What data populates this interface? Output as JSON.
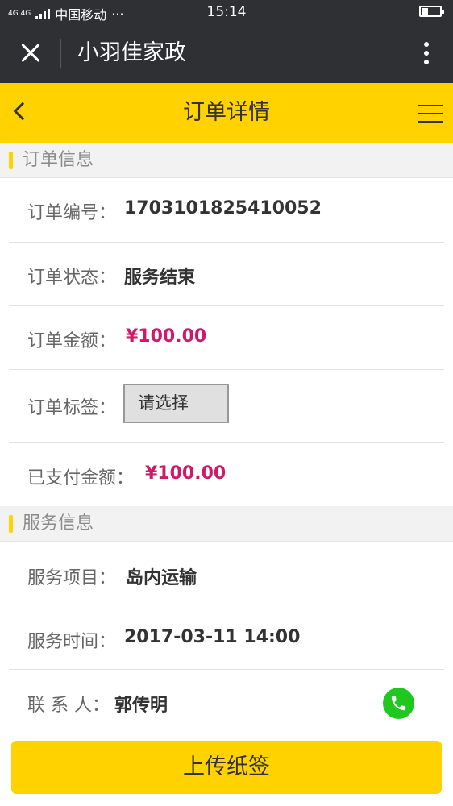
{
  "statusbar": {
    "network": "4G 4G",
    "carrier": "中国移动",
    "dots": "···",
    "time": "15:14"
  },
  "wechat": {
    "title": "小羽佳家政"
  },
  "header": {
    "title": "订单详情"
  },
  "order_section": {
    "title": "订单信息",
    "order_number_label": "订单编号：",
    "order_number": "1703101825410052",
    "status_label": "订单状态：",
    "status": "服务结束",
    "amount_label": "订单金额：",
    "amount": "¥100.00",
    "tag_label": "订单标签：",
    "tag_select": "请选择",
    "paid_label": "已支付金额：",
    "paid": "¥100.00"
  },
  "service_section": {
    "title": "服务信息",
    "item_label": "服务项目：",
    "item": "岛内运输",
    "time_label": "服务时间：",
    "time": "2017-03-11 14:00",
    "contact_label": "联 系 人：",
    "contact": "郭传明"
  },
  "footer": {
    "button": "上传纸签"
  },
  "colors": {
    "accent": "#ffd200",
    "money": "#d0196a",
    "phone": "#1fc81f",
    "dark_bar": "#2e3034"
  }
}
